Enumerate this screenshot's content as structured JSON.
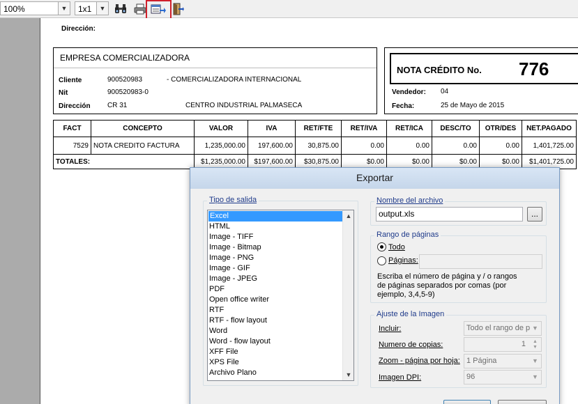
{
  "toolbar": {
    "zoom": "100%",
    "pages_layout": "1x1"
  },
  "report": {
    "direccion_top_label": "Dirección:",
    "company": {
      "name": "EMPRESA COMERCIALIZADORA",
      "cliente_label": "Cliente",
      "cliente_id": "900520983",
      "cliente_name": "- COMERCIALIZADORA INTERNACIONAL",
      "nit_label": "Nit",
      "nit_value": "900520983-0",
      "direccion_label": "Dirección",
      "direccion_value": "CR 31",
      "direccion_place": "CENTRO INDUSTRIAL PALMASECA"
    },
    "nota": {
      "title": "NOTA CRÉDITO No.",
      "number": "776",
      "vendedor_label": "Vendedor:",
      "vendedor_value": "04",
      "fecha_label": "Fecha:",
      "fecha_value": "25 de Mayo de 2015"
    },
    "table": {
      "headers": [
        "FACT",
        "CONCEPTO",
        "VALOR",
        "IVA",
        "RET/FTE",
        "RET/IVA",
        "RET/ICA",
        "DESC/TO",
        "OTR/DES",
        "NET.PAGADO"
      ],
      "row": [
        "7529",
        "NOTA CREDITO FACTURA",
        "1,235,000.00",
        "197,600.00",
        "30,875.00",
        "0.00",
        "0.00",
        "0.00",
        "0.00",
        "1,401,725.00"
      ],
      "totals_label": "TOTALES:",
      "totals": [
        "$1,235,000.00",
        "$197,600.00",
        "$30,875.00",
        "$0.00",
        "$0.00",
        "$0.00",
        "$0.00",
        "$1,401,725.00"
      ]
    }
  },
  "dialog": {
    "title": "Exportar",
    "output_group_title": "Tipo de salida",
    "output_types": [
      "Excel",
      "HTML",
      "Image - TIFF",
      "Image - Bitmap",
      "Image - PNG",
      "Image - GIF",
      "Image - JPEG",
      "PDF",
      "Open office writer",
      "RTF",
      "RTF - flow layout",
      "Word",
      "Word - flow layout",
      "XFF File",
      "XPS File",
      "Archivo Plano"
    ],
    "selected_output": "Excel",
    "file_group_title": "Nombre del archivo",
    "file_name": "output.xls",
    "browse_label": "...",
    "range_group_title": "Rango de páginas",
    "range_all_label": "Todo",
    "range_pages_label": "Páginas:",
    "range_hint_1": "Escriba el número de página y / o rangos",
    "range_hint_2": "de páginas separados por comas (por",
    "range_hint_3": "ejemplo, 3,4,5-9)",
    "image_group_title": "Ajuste de la Imagen",
    "incluir_label": "Incluir:",
    "incluir_value": "Todo el rango de p",
    "copies_label": "Numero de copias:",
    "copies_value": "1",
    "zoom_label": "Zoom - página por hoja:",
    "zoom_value": "1 Página",
    "dpi_label": "Imagen DPI:",
    "dpi_value": "96"
  }
}
